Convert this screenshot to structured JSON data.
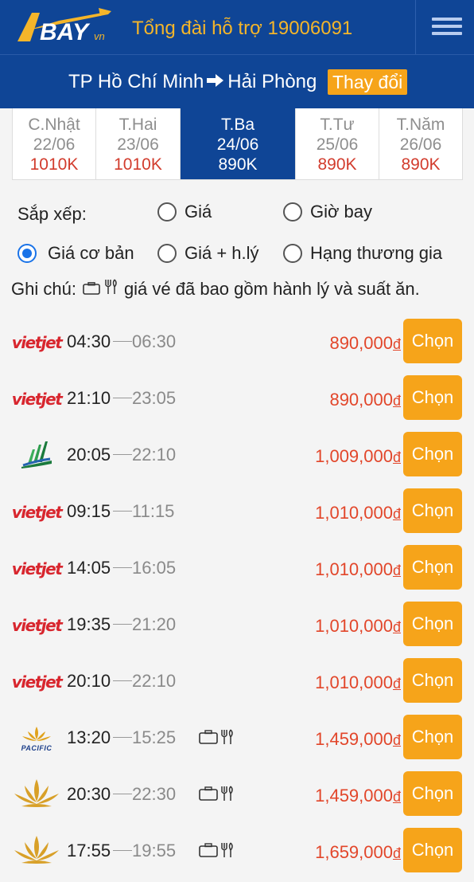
{
  "header": {
    "logo_text": "BAY",
    "logo_suffix": "vn",
    "hotline": "Tổng đài hỗ trợ 19006091"
  },
  "route": {
    "from": "TP Hồ Chí Minh",
    "to": "Hải Phòng",
    "change_label": "Thay đổi"
  },
  "date_tabs": [
    {
      "day": "C.Nhật",
      "date": "22/06",
      "price": "1010K",
      "active": false
    },
    {
      "day": "T.Hai",
      "date": "23/06",
      "price": "1010K",
      "active": false
    },
    {
      "day": "T.Ba",
      "date": "24/06",
      "price": "890K",
      "active": true
    },
    {
      "day": "T.Tư",
      "date": "25/06",
      "price": "890K",
      "active": false
    },
    {
      "day": "T.Năm",
      "date": "26/06",
      "price": "890K",
      "active": false
    }
  ],
  "sort": {
    "label": "Sắp xếp:",
    "options": [
      {
        "label": "Giá",
        "checked": false
      },
      {
        "label": "Giờ bay",
        "checked": false
      },
      {
        "label": "Giá cơ bản",
        "checked": true
      },
      {
        "label": "Giá + h.lý",
        "checked": false
      },
      {
        "label": "Hạng thương gia",
        "checked": false
      }
    ]
  },
  "note": {
    "prefix": "Ghi chú:",
    "text": "giá vé đã bao gồm hành lý và suất ăn."
  },
  "choose_label": "Chọn",
  "currency": "đ",
  "flights": [
    {
      "airline": "vietjet",
      "logo_text": "vietjet",
      "depart": "04:30",
      "arrive": "06:30",
      "price": "890,000",
      "baggage_meal": false
    },
    {
      "airline": "vietjet",
      "logo_text": "vietjet",
      "depart": "21:10",
      "arrive": "23:05",
      "price": "890,000",
      "baggage_meal": false
    },
    {
      "airline": "bamboo",
      "logo_text": "",
      "depart": "20:05",
      "arrive": "22:10",
      "price": "1,009,000",
      "baggage_meal": false
    },
    {
      "airline": "vietjet",
      "logo_text": "vietjet",
      "depart": "09:15",
      "arrive": "11:15",
      "price": "1,010,000",
      "baggage_meal": false
    },
    {
      "airline": "vietjet",
      "logo_text": "vietjet",
      "depart": "14:05",
      "arrive": "16:05",
      "price": "1,010,000",
      "baggage_meal": false
    },
    {
      "airline": "vietjet",
      "logo_text": "vietjet",
      "depart": "19:35",
      "arrive": "21:20",
      "price": "1,010,000",
      "baggage_meal": false
    },
    {
      "airline": "vietjet",
      "logo_text": "vietjet",
      "depart": "20:10",
      "arrive": "22:10",
      "price": "1,010,000",
      "baggage_meal": false
    },
    {
      "airline": "pacific",
      "logo_text": "PACIFIC",
      "depart": "13:20",
      "arrive": "15:25",
      "price": "1,459,000",
      "baggage_meal": true
    },
    {
      "airline": "vietnam-airlines",
      "logo_text": "",
      "depart": "20:30",
      "arrive": "22:30",
      "price": "1,459,000",
      "baggage_meal": true
    },
    {
      "airline": "vietnam-airlines",
      "logo_text": "",
      "depart": "17:55",
      "arrive": "19:55",
      "price": "1,659,000",
      "baggage_meal": true
    }
  ]
}
